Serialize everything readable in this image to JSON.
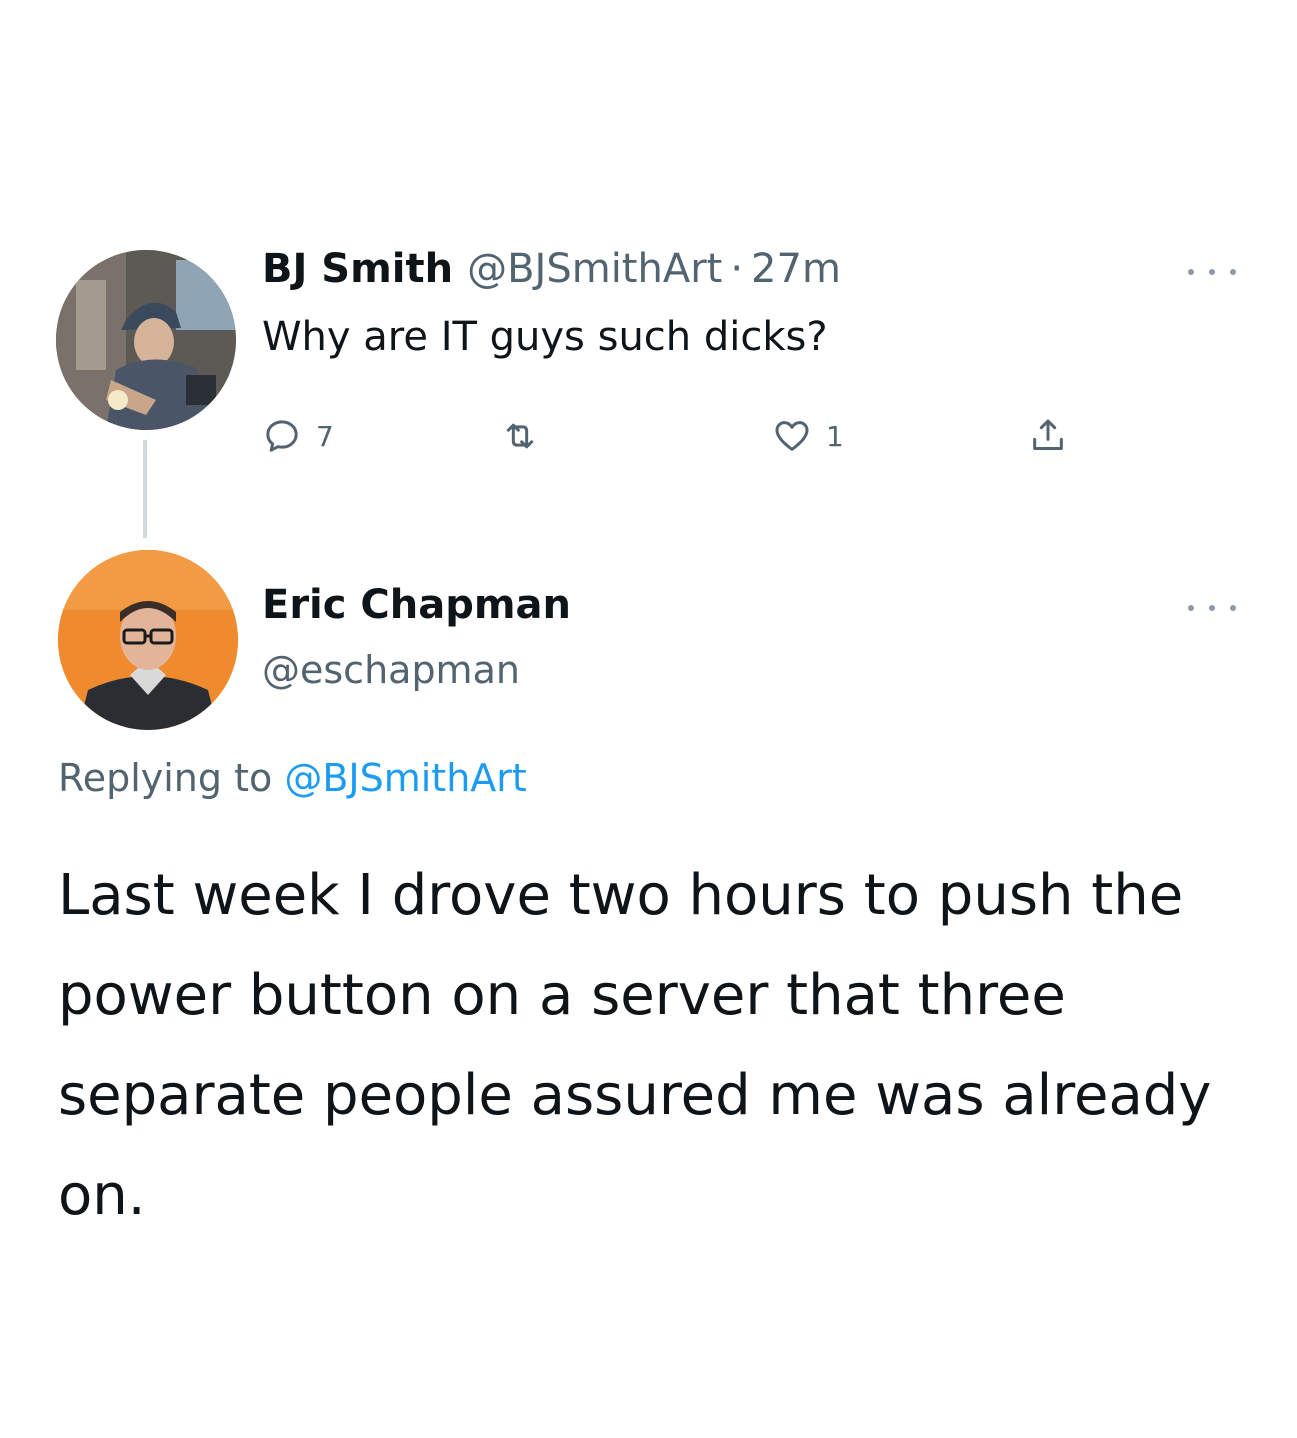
{
  "parent_tweet": {
    "author_name": "BJ Smith",
    "handle": "@BJSmithArt",
    "separator": "·",
    "time": "27m",
    "text": "Why are IT guys such dicks?",
    "actions": {
      "reply_count": "7",
      "retweet_count": "",
      "like_count": "1"
    },
    "avatar": "bj-smith-profile-photo"
  },
  "reply_tweet": {
    "author_name": "Eric Chapman",
    "handle": "@eschapman",
    "replying_prefix": "Replying to",
    "replying_to": "@BJSmithArt",
    "body": "Last week I drove two hours to push the power button on a server that three separate people assured me was already on.",
    "avatar": "eric-chapman-profile-photo"
  },
  "icons": {
    "reply": "reply-icon",
    "retweet": "retweet-icon",
    "like": "heart-icon",
    "share": "share-icon",
    "more": "more-icon"
  },
  "colors": {
    "text_primary": "#0f1419",
    "text_secondary": "#536471",
    "link": "#1d9bf0",
    "thread_line": "#cfd9de",
    "reply_avatar_bg": "#f08a2e"
  }
}
